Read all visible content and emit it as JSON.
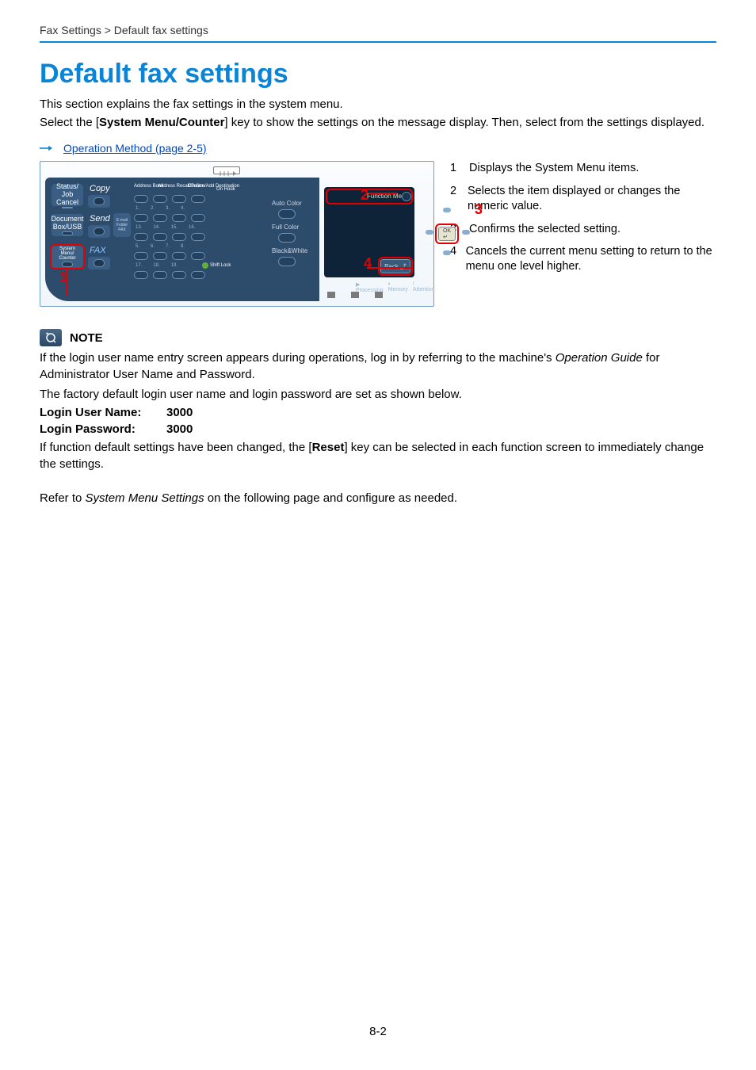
{
  "breadcrumb": "Fax Settings > Default fax settings",
  "title": "Default fax settings",
  "intro1": "This section explains the fax settings in the system menu.",
  "intro2a": "Select the [",
  "intro2b": "System Menu/Counter",
  "intro2c": "] key to show the settings on the message display. Then, select from the settings displayed.",
  "link": "Operation Method (page 2-5)",
  "legend": {
    "1": {
      "n": "1",
      "t": "Displays the System Menu items."
    },
    "2": {
      "n": "2",
      "t": "Selects the item displayed or changes the numeric value."
    },
    "3": {
      "n": "3",
      "t": "Confirms the selected setting."
    },
    "4": {
      "n": "4",
      "t": "Cancels the current menu setting to return to the menu one level higher."
    }
  },
  "panel": {
    "status": "Status/\nJob Cancel",
    "copy": "Copy",
    "docbox": "Document\nBox/USB",
    "send": "Send",
    "sysmenu": "System Menu/\nCounter",
    "fax": "FAX",
    "emailFolder": "E-mail\nFolder\nFAX",
    "addrbook": "Address\nBook",
    "addrrecall": "Address\nRecall/Pause",
    "confirm": "Confirm/Add\nDestination",
    "onhook": "On Hook",
    "autocolor": "Auto Color",
    "fullcolor": "Full Color",
    "bw": "Black&White",
    "funcmenu": "Function Menu",
    "back": "Back",
    "processing": "Processing",
    "memory": "Memory",
    "attention": "Attention"
  },
  "note": {
    "label": "NOTE",
    "p1a": "If the login user name entry screen appears during operations, log in by referring to the machine's ",
    "p1b": "Operation Guide",
    "p1c": " for Administrator User Name and Password.",
    "p2": "The factory default login user name and login password are set as shown below.",
    "userLabel": "Login User Name:",
    "userVal": "3000",
    "passLabel": "Login Password:",
    "passVal": "3000",
    "p3a": "If function default settings have been changed, the [",
    "p3b": "Reset",
    "p3c": "] key can be selected in each function screen to immediately change the settings."
  },
  "after": {
    "a": "Refer to ",
    "b": "System Menu Settings",
    "c": " on the following page and configure as needed."
  },
  "page": "8-2"
}
